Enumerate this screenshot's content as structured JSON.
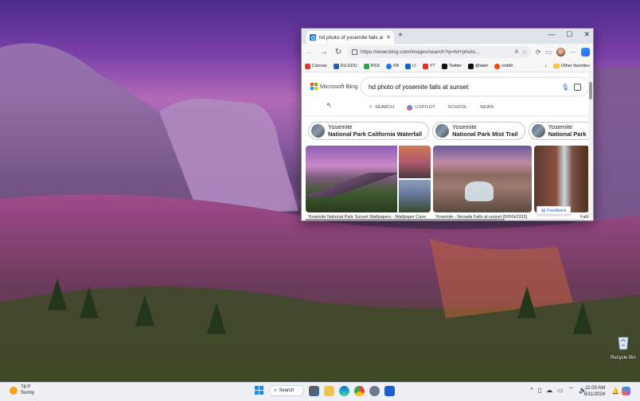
{
  "desktop": {
    "recycle_bin_label": "Recycle Bin"
  },
  "browser": {
    "tab": {
      "title": "hd photo of yosemite falls at sun",
      "close_glyph": "✕"
    },
    "new_tab_glyph": "+",
    "window_controls": {
      "minimize": "—",
      "maximize": "☐",
      "close": "✕"
    },
    "url": "https://www.bing.com/images/search?q=hd+photo...",
    "favorites": [
      {
        "label": "Canvas",
        "color": "#d83b2e"
      },
      {
        "label": "DU.EDU",
        "color": "#2a5fb0"
      },
      {
        "label": "RSS",
        "color": "#2aa84a"
      },
      {
        "label": "FB",
        "color": "#1877f2"
      },
      {
        "label": "LI",
        "color": "#0a66c2"
      },
      {
        "label": "YT",
        "color": "#e52d27"
      },
      {
        "label": "Twitter",
        "color": "#111111"
      },
      {
        "label": "@later",
        "color": "#111111"
      },
      {
        "label": "reddit",
        "color": "#ff4500"
      }
    ],
    "other_favorites": "Other favorites"
  },
  "bing": {
    "logo_text": "Microsoft Bing",
    "query": "hd photo of yosemite falls at sunset",
    "scopes": {
      "search": "SEARCH",
      "copilot": "COPILOT",
      "school": "SCHOOL",
      "news": "NEWS"
    },
    "pills": [
      {
        "line1": "Yosemite",
        "line2": "National Park California Waterfall"
      },
      {
        "line1": "Yosemite",
        "line2": "National Park Mist Trail"
      },
      {
        "line1": "Yosemite",
        "line2": "National Park Spri"
      }
    ],
    "captions": [
      "Yosemite National Park Sunset Wallpapers - Wallpaper Cave",
      "Yosemite - Nevada Falls at sunset [5000x3333]",
      "Falls,"
    ],
    "feedback": "Feedback"
  },
  "taskbar": {
    "weather": {
      "temp": "76°F",
      "condition": "Sunny"
    },
    "search_label": "Search",
    "clock": {
      "time": "11:00 AM",
      "date": "6/11/2024"
    }
  }
}
